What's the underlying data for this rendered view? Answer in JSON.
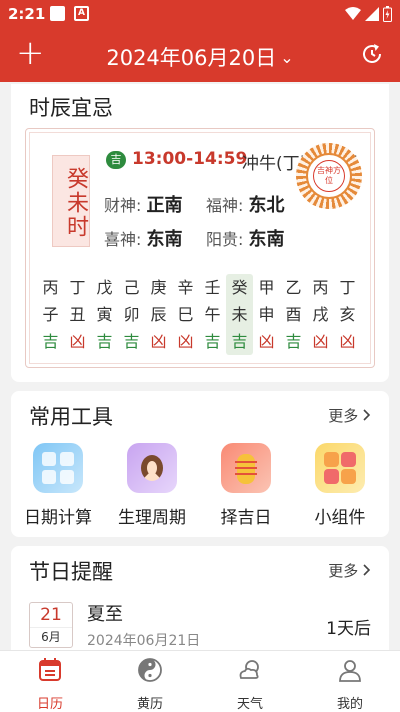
{
  "status_bar": {
    "time": "2:21",
    "notif_letter": "A"
  },
  "header": {
    "title": "2024年06月20日",
    "dropdown": "⌄",
    "add": "+"
  },
  "shichen": {
    "title": "时辰宜忌",
    "current_hour": "癸未时",
    "luck_badge": "吉",
    "time_range": "13:00-14:59",
    "conflict": "冲牛(丁丑)煞西",
    "gods": [
      {
        "name": "财神:",
        "dir": "正南"
      },
      {
        "name": "福神:",
        "dir": "东北"
      },
      {
        "name": "喜神:",
        "dir": "东南"
      },
      {
        "name": "阳贵:",
        "dir": "东南"
      }
    ],
    "wheel_text": "吉神方位",
    "hours": [
      {
        "top": "丙",
        "mid": "子",
        "luck": "吉",
        "good": true
      },
      {
        "top": "丁",
        "mid": "丑",
        "luck": "凶",
        "good": false
      },
      {
        "top": "戊",
        "mid": "寅",
        "luck": "吉",
        "good": true
      },
      {
        "top": "己",
        "mid": "卯",
        "luck": "吉",
        "good": true
      },
      {
        "top": "庚",
        "mid": "辰",
        "luck": "凶",
        "good": false
      },
      {
        "top": "辛",
        "mid": "巳",
        "luck": "凶",
        "good": false
      },
      {
        "top": "壬",
        "mid": "午",
        "luck": "吉",
        "good": true
      },
      {
        "top": "癸",
        "mid": "未",
        "luck": "吉",
        "good": true,
        "active": true
      },
      {
        "top": "甲",
        "mid": "申",
        "luck": "凶",
        "good": false
      },
      {
        "top": "乙",
        "mid": "酉",
        "luck": "吉",
        "good": true
      },
      {
        "top": "丙",
        "mid": "戌",
        "luck": "凶",
        "good": false
      },
      {
        "top": "丁",
        "mid": "亥",
        "luck": "凶",
        "good": false
      }
    ]
  },
  "tools": {
    "title": "常用工具",
    "more": "更多",
    "items": [
      {
        "label": "日期计算",
        "icon": "calculator-icon"
      },
      {
        "label": "生理周期",
        "icon": "woman-icon"
      },
      {
        "label": "择吉日",
        "icon": "lantern-icon"
      },
      {
        "label": "小组件",
        "icon": "puzzle-icon"
      }
    ]
  },
  "festivals": {
    "title": "节日提醒",
    "more": "更多",
    "item": {
      "day": "21",
      "month": "6月",
      "name": "夏至",
      "date": "2024年06月21日",
      "countdown": "1天后"
    }
  },
  "nav": [
    {
      "label": "日历",
      "icon": "calendar-icon",
      "active": true
    },
    {
      "label": "黄历",
      "icon": "yin-yang-icon"
    },
    {
      "label": "天气",
      "icon": "weather-icon"
    },
    {
      "label": "我的",
      "icon": "profile-icon"
    }
  ],
  "colors": {
    "brand": "#d83a2c",
    "good": "#2e8b3e",
    "bad": "#c8392c"
  }
}
